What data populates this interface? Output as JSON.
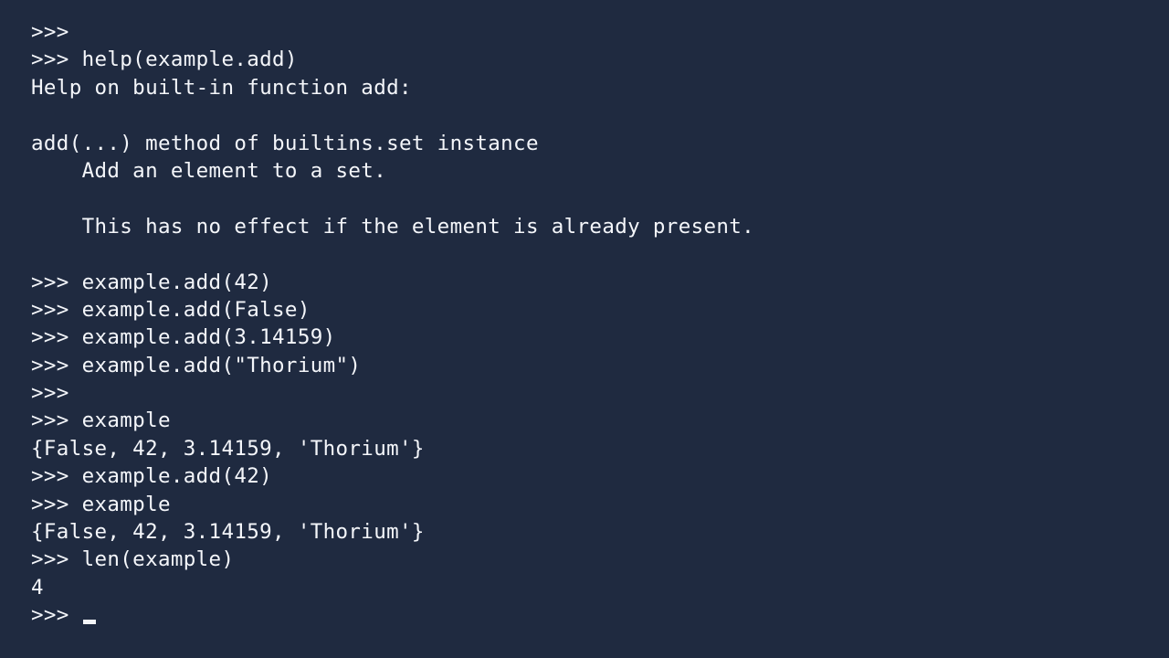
{
  "terminal": {
    "lines": [
      ">>>",
      ">>> help(example.add)",
      "Help on built-in function add:",
      "",
      "add(...) method of builtins.set instance",
      "    Add an element to a set.",
      "",
      "    This has no effect if the element is already present.",
      "",
      ">>> example.add(42)",
      ">>> example.add(False)",
      ">>> example.add(3.14159)",
      ">>> example.add(\"Thorium\")",
      ">>>",
      ">>> example",
      "{False, 42, 3.14159, 'Thorium'}",
      ">>> example.add(42)",
      ">>> example",
      "{False, 42, 3.14159, 'Thorium'}",
      ">>> len(example)",
      "4"
    ],
    "prompt": ">>> "
  }
}
